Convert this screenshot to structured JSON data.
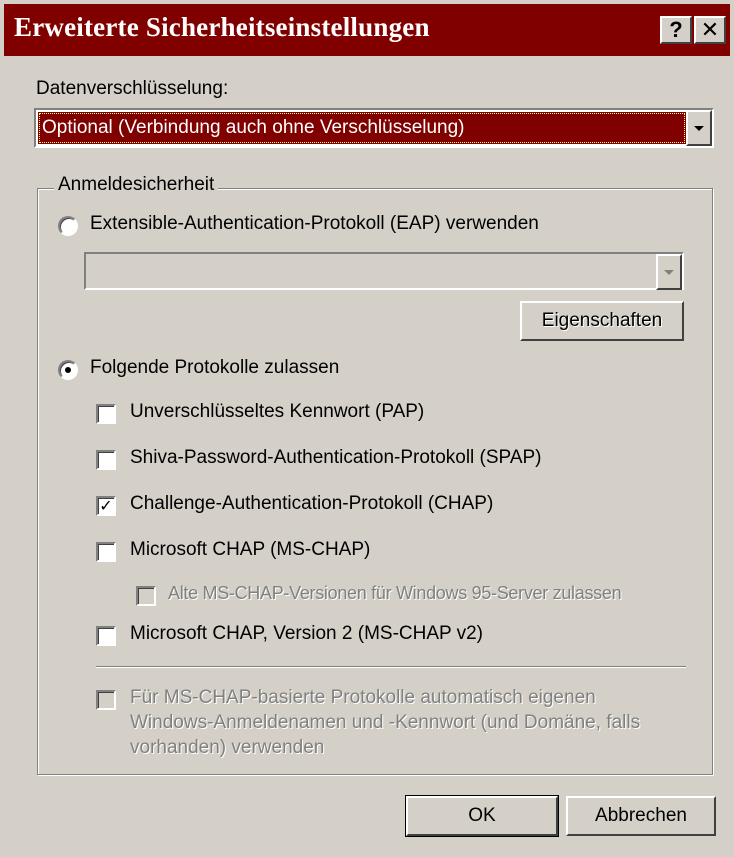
{
  "window": {
    "title": "Erweiterte Sicherheitseinstellungen",
    "help_button": "?",
    "close_button": "✕"
  },
  "encryption": {
    "label": "Datenverschlüsselung:",
    "selected": "Optional (Verbindung auch ohne Verschlüsselung)"
  },
  "logon_security": {
    "group_label": "Anmeldesicherheit",
    "eap_radio": {
      "label": "Extensible-Authentication-Protokoll (EAP) verwenden",
      "selected": false
    },
    "eap_combo": {
      "value": "",
      "enabled": false
    },
    "properties_button": "Eigenschaften",
    "protocols_radio": {
      "label": "Folgende Protokolle zulassen",
      "selected": true
    },
    "protocols": [
      {
        "label": "Unverschlüsseltes Kennwort (PAP)",
        "checked": false,
        "enabled": true
      },
      {
        "label": "Shiva-Password-Authentication-Protokoll (SPAP)",
        "checked": false,
        "enabled": true
      },
      {
        "label": "Challenge-Authentication-Protokoll (CHAP)",
        "checked": true,
        "enabled": true
      },
      {
        "label": "Microsoft CHAP (MS-CHAP)",
        "checked": false,
        "enabled": true
      },
      {
        "label": "Alte MS-CHAP-Versionen für Windows 95-Server zulassen",
        "checked": false,
        "enabled": false
      },
      {
        "label": "Microsoft CHAP, Version 2 (MS-CHAP v2)",
        "checked": false,
        "enabled": true
      }
    ],
    "auto_logon": {
      "line1": "Für MS-CHAP-basierte Protokolle automatisch eigenen",
      "line2": "Windows-Anmeldenamen und -Kennwort (und Domäne, falls",
      "line3": "vorhanden) verwenden",
      "checked": false,
      "enabled": false
    }
  },
  "buttons": {
    "ok": "OK",
    "cancel": "Abbrechen"
  },
  "colors": {
    "title_bar": "#800000",
    "selection": "#800000",
    "face": "#d4d0c8"
  }
}
